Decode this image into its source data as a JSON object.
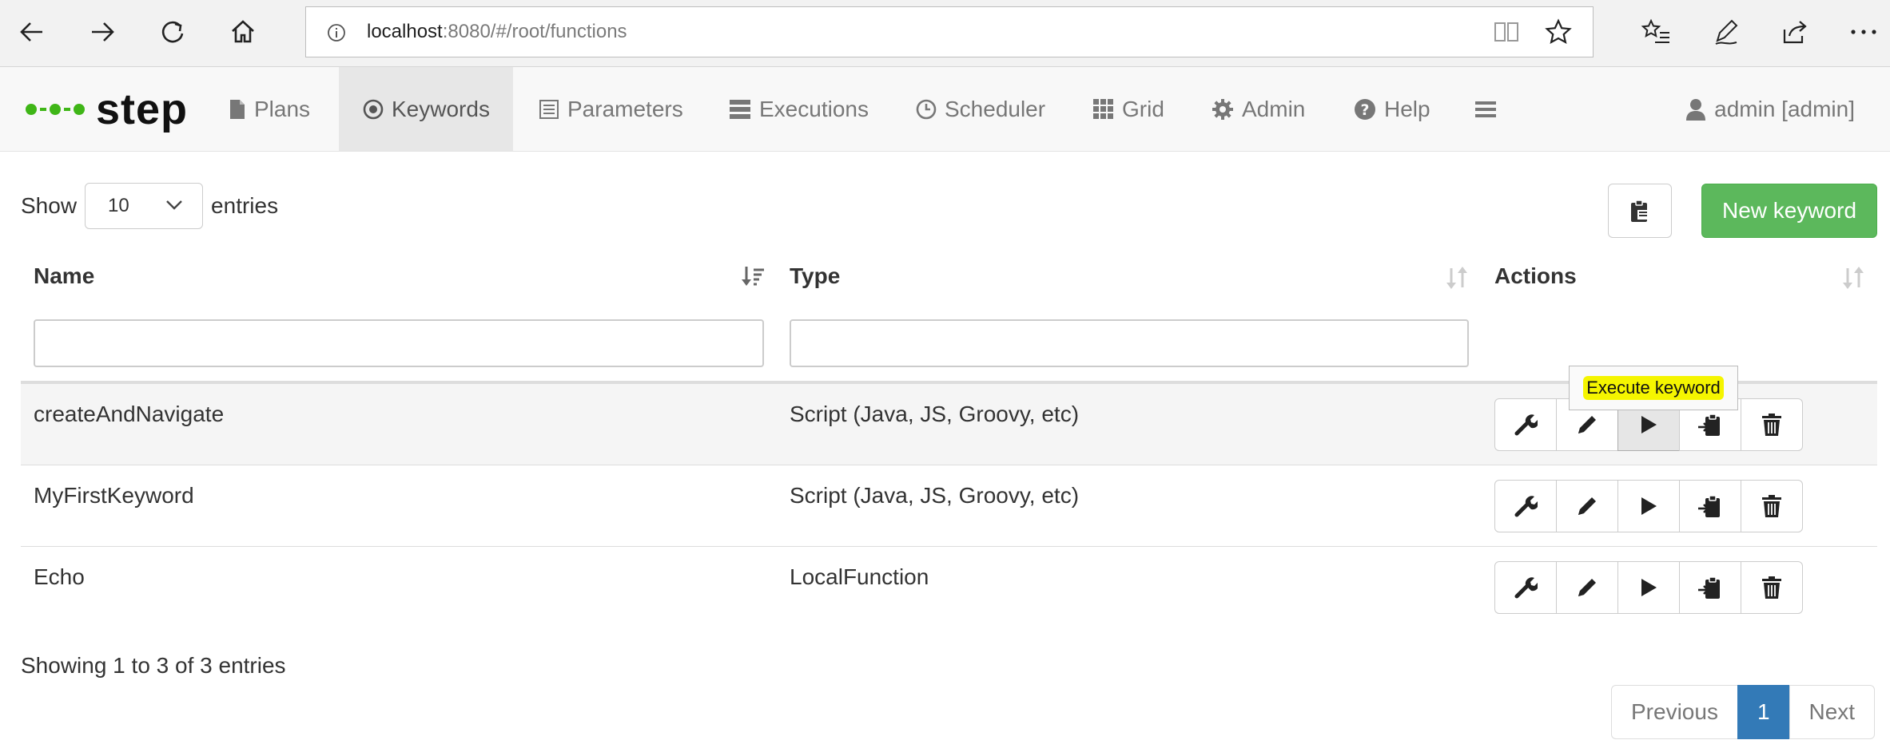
{
  "browser": {
    "url_host": "localhost",
    "url_rest": ":8080/#/root/functions"
  },
  "brand": {
    "name": "step",
    "color": "#3fb617"
  },
  "nav": {
    "items": [
      {
        "label": "Plans",
        "icon": "file-icon"
      },
      {
        "label": "Keywords",
        "icon": "target-icon",
        "active": true
      },
      {
        "label": "Parameters",
        "icon": "list-icon"
      },
      {
        "label": "Executions",
        "icon": "stack-icon"
      },
      {
        "label": "Scheduler",
        "icon": "clock-icon"
      },
      {
        "label": "Grid",
        "icon": "grid-icon"
      },
      {
        "label": "Admin",
        "icon": "gear-icon"
      },
      {
        "label": "Help",
        "icon": "question-icon"
      }
    ],
    "user": "admin [admin]"
  },
  "table_controls": {
    "show_label": "Show",
    "page_size": "10",
    "entries_label": "entries",
    "new_button": "New keyword"
  },
  "table": {
    "columns": [
      "Name",
      "Type",
      "Actions"
    ],
    "rows": [
      {
        "name": "createAndNavigate",
        "type": "Script (Java, JS, Groovy, etc)"
      },
      {
        "name": "MyFirstKeyword",
        "type": "Script (Java, JS, Groovy, etc)"
      },
      {
        "name": "Echo",
        "type": "LocalFunction"
      }
    ]
  },
  "tooltip": "Execute keyword",
  "info": "Showing 1 to 3 of 3 entries",
  "pagination": {
    "previous": "Previous",
    "current": "1",
    "next": "Next"
  },
  "colors": {
    "primary": "#337ab7",
    "success": "#5cb85c",
    "highlight": "#f5f500"
  }
}
